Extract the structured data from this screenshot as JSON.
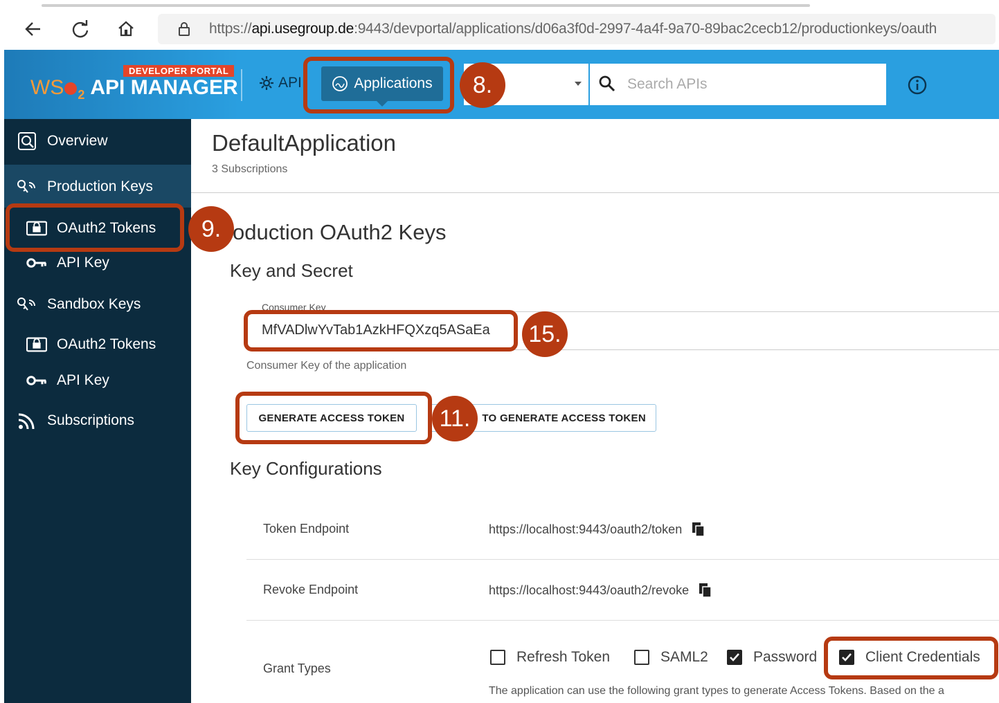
{
  "browser": {
    "url_prefix": "https://",
    "url_host": "api.usegroup.de",
    "url_rest": ":9443/devportal/applications/d06a3f0d-2997-4a4f-9a70-89bac2cecb12/productionkeys/oauth"
  },
  "header": {
    "portal_badge": "DEVELOPER PORTAL",
    "brand_prefix": "WS",
    "brand_sub": "2",
    "brand_name": "API MANAGER",
    "apis_label": "API",
    "applications_label": "Applications",
    "search_placeholder": "Search APIs"
  },
  "sidebar": {
    "items": [
      {
        "label": "Overview"
      },
      {
        "label": "Production Keys"
      },
      {
        "label": "OAuth2 Tokens"
      },
      {
        "label": "API Key"
      },
      {
        "label": "Sandbox Keys"
      },
      {
        "label": "OAuth2 Tokens"
      },
      {
        "label": "API Key"
      },
      {
        "label": "Subscriptions"
      }
    ]
  },
  "main": {
    "app_name": "DefaultApplication",
    "subscriptions": "3 Subscriptions",
    "section_title": "oduction OAuth2 Keys",
    "key_secret_title": "Key and Secret",
    "consumer_key_label": "Consumer Key",
    "consumer_key_value": "MfVADlwYvTab1AzkHFQXzq5ASaEa",
    "consumer_key_help": "Consumer Key of the application",
    "generate_button": "GENERATE ACCESS TOKEN",
    "curl_button": "TO GENERATE ACCESS TOKEN",
    "key_config_title": "Key Configurations",
    "token_endpoint_label": "Token Endpoint",
    "token_endpoint_value": "https://localhost:9443/oauth2/token",
    "revoke_endpoint_label": "Revoke Endpoint",
    "revoke_endpoint_value": "https://localhost:9443/oauth2/revoke",
    "grant_types_label": "Grant Types",
    "grants": [
      {
        "label": "Refresh Token",
        "checked": false
      },
      {
        "label": "SAML2",
        "checked": false
      },
      {
        "label": "Password",
        "checked": true
      },
      {
        "label": "Client Credentials",
        "checked": true
      }
    ],
    "grant_help": "The application can use the following grant types to generate Access Tokens. Based on the a"
  },
  "annotations": {
    "step_8": "8.",
    "step_9": "9.",
    "step_15": "15.",
    "step_11": "11."
  },
  "colors": {
    "header": "#2a9fe0",
    "sidebar": "#0c2b3e",
    "annotation": "#b63a12"
  }
}
